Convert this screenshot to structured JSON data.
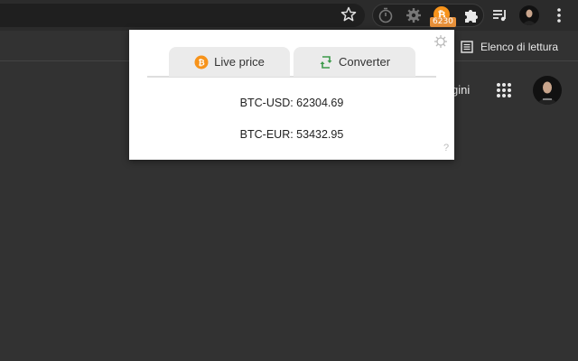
{
  "toolbar": {
    "extensions": [
      {
        "icon": "stopwatch-icon"
      },
      {
        "icon": "settings-gear-icon"
      },
      {
        "icon": "bitcoin-icon",
        "badge": "6230"
      }
    ],
    "puzzle_icon": "puzzle-icon",
    "media_icon": "media-queue-icon",
    "menu_icon": "kebab-menu-icon"
  },
  "bookmarks": {
    "reading_list_label": "Elenco di lettura"
  },
  "page": {
    "partial_text": "gini"
  },
  "popup": {
    "tabs": [
      {
        "label": "Live price",
        "icon": "bitcoin-icon"
      },
      {
        "label": "Converter",
        "icon": "convert-arrows-icon"
      }
    ],
    "prices": [
      {
        "text": "BTC-USD: 62304.69"
      },
      {
        "text": "BTC-EUR: 53432.95"
      }
    ],
    "help_label": "?",
    "settings_icon": "gear-icon"
  },
  "colors": {
    "bitcoin_orange": "#f7931a",
    "badge": "#e8913a",
    "converter_green": "#3c9a4a"
  }
}
